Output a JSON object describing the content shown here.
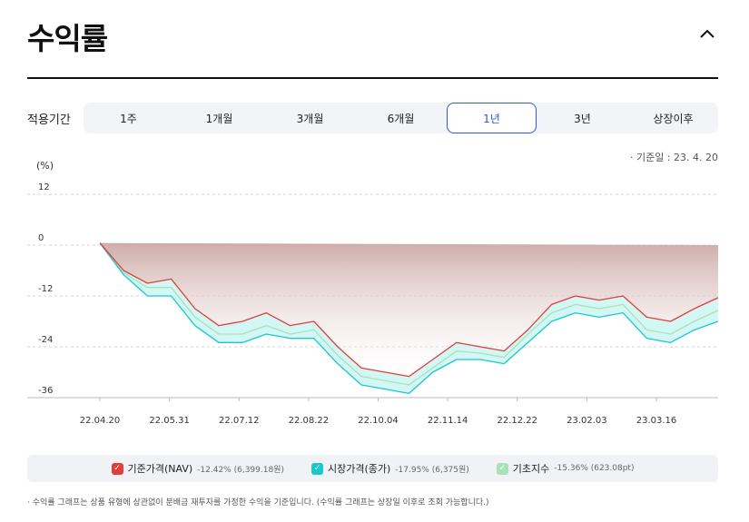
{
  "header": {
    "title": "수익률",
    "collapse_icon": "chevron-up-icon"
  },
  "period": {
    "label": "적용기간",
    "options": [
      "1주",
      "1개월",
      "3개월",
      "6개월",
      "1년",
      "3년",
      "상장이후"
    ],
    "selected": "1년"
  },
  "base_date": "기준일 : 23. 4. 20",
  "unit_label": "(%)",
  "colors": {
    "nav": "#e0403a",
    "market": "#18c9c9",
    "index": "#a6e3b8",
    "area_top": "#c9a49f"
  },
  "chart_data": {
    "type": "line",
    "ylabel": "(%)",
    "ylim": [
      -36,
      12
    ],
    "yticks": [
      "12",
      "0",
      "-12",
      "-24",
      "-36"
    ],
    "x": [
      "22.04.20",
      "22.05.04",
      "22.05.18",
      "22.06.01",
      "22.06.15",
      "22.06.29",
      "22.07.13",
      "22.07.27",
      "22.08.10",
      "22.08.24",
      "22.09.07",
      "22.09.21",
      "22.10.05",
      "22.10.19",
      "22.11.02",
      "22.11.16",
      "22.11.30",
      "22.12.14",
      "22.12.28",
      "23.01.11",
      "23.01.25",
      "23.02.08",
      "23.02.22",
      "23.03.08",
      "23.03.22",
      "23.04.05",
      "23.04.20"
    ],
    "xticks": [
      "22.04.20",
      "22.05.31",
      "22.07.12",
      "22.08.22",
      "22.10.04",
      "22.11.14",
      "22.12.22",
      "23.02.03",
      "23.03.16"
    ],
    "series": [
      {
        "name": "기준가격(NAV)",
        "values": [
          0.5,
          -6,
          -9,
          -8,
          -15,
          -19,
          -18,
          -16,
          -19,
          -18,
          -24,
          -29,
          -30,
          -31,
          -27,
          -23,
          -24,
          -25,
          -20,
          -14,
          -12,
          -13,
          -12,
          -17,
          -18,
          -15,
          -12.4
        ]
      },
      {
        "name": "시장가격(종가)",
        "values": [
          0.5,
          -7,
          -12,
          -12,
          -19,
          -23,
          -23,
          -21,
          -22,
          -22,
          -28,
          -33,
          -34,
          -35,
          -30,
          -27,
          -27,
          -28,
          -23,
          -18,
          -16,
          -17,
          -16,
          -22,
          -23,
          -20,
          -18
        ]
      },
      {
        "name": "기초지수",
        "values": [
          0.5,
          -6.5,
          -10,
          -10,
          -17,
          -21,
          -21,
          -19,
          -21,
          -20,
          -26,
          -31,
          -32,
          -33,
          -29,
          -25,
          -25.5,
          -26.5,
          -21,
          -16,
          -14,
          -15,
          -14,
          -20,
          -21,
          -18,
          -15.4
        ]
      }
    ]
  },
  "legend": [
    {
      "name": "기준가격(NAV)",
      "value": "-12.42% (6,399.18원)"
    },
    {
      "name": "시장가격(종가)",
      "value": "-17.95% (6,375원)"
    },
    {
      "name": "기초지수",
      "value": "-15.36% (623.08pt)"
    }
  ],
  "footnote": "· 수익률 그래프는 상품 유형에 상관없이 분배금 재투자를 가정한 수익을 기준입니다. (수익률 그래프는 상장일 이후로 조회 가능합니다.)"
}
